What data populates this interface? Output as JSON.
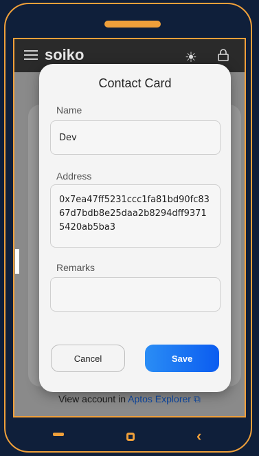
{
  "app": {
    "logo_text": "soiko"
  },
  "background": {
    "footer_prefix": "View account in",
    "footer_link": "Aptos Explorer",
    "footer_icon": "external-link-icon"
  },
  "modal": {
    "title": "Contact Card",
    "name": {
      "label": "Name",
      "value": "Dev"
    },
    "address": {
      "label": "Address",
      "value": "0x7ea47ff5231ccc1fa81bd90fc8367d7bdb8e25daa2b8294dff93715420ab5ba3"
    },
    "remarks": {
      "label": "Remarks",
      "value": ""
    },
    "cancel_label": "Cancel",
    "save_label": "Save"
  },
  "colors": {
    "frame": "#f0a03a",
    "accent": "#0b5cf0",
    "bg": "#0f1f3a"
  }
}
